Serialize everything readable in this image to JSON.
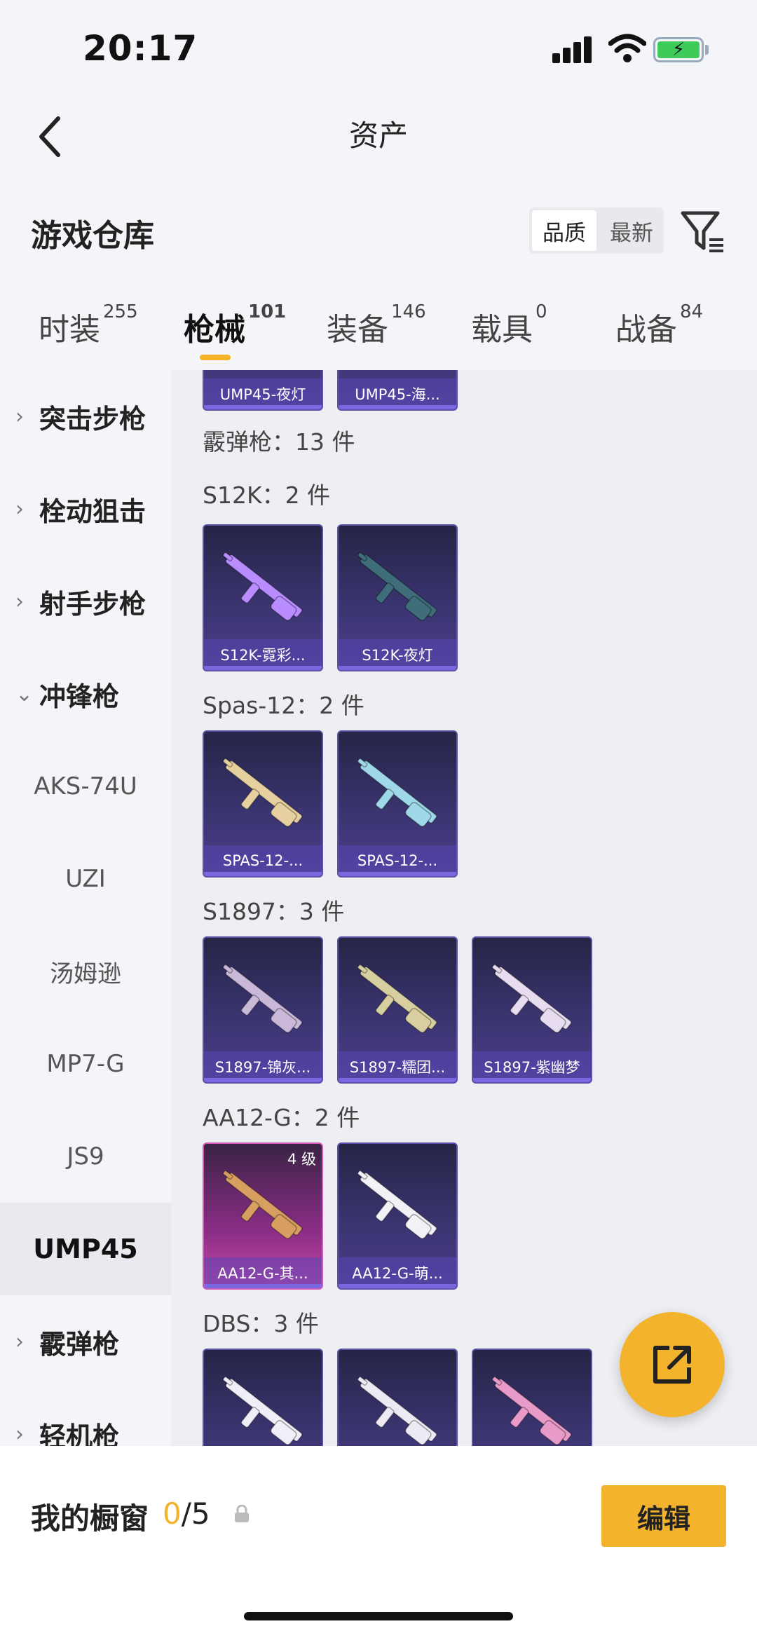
{
  "status": {
    "time": "20:17"
  },
  "nav": {
    "title": "资产"
  },
  "header": {
    "title": "游戏仓库",
    "sort_quality": "品质",
    "sort_latest": "最新"
  },
  "tabs": [
    {
      "label": "时装",
      "count": "255"
    },
    {
      "label": "枪械",
      "count": "101"
    },
    {
      "label": "装备",
      "count": "146"
    },
    {
      "label": "载具",
      "count": "0"
    },
    {
      "label": "战备",
      "count": "84"
    }
  ],
  "sidebar": {
    "items": [
      {
        "label": "突击步枪",
        "chevron": "›"
      },
      {
        "label": "栓动狙击",
        "chevron": "›"
      },
      {
        "label": "射手步枪",
        "chevron": "›"
      },
      {
        "label": "冲锋枪",
        "chevron": "⌄"
      },
      {
        "label": "AKS-74U"
      },
      {
        "label": "UZI"
      },
      {
        "label": "汤姆逊"
      },
      {
        "label": "MP7-G"
      },
      {
        "label": "JS9"
      },
      {
        "label": "UMP45"
      },
      {
        "label": "霰弹枪",
        "chevron": "›"
      },
      {
        "label": "轻机枪",
        "chevron": "›"
      }
    ]
  },
  "content": {
    "top_cards": [
      "UMP45-夜灯",
      "UMP45-海..."
    ],
    "category_title": "霰弹枪：13 件",
    "groups": [
      {
        "title": "S12K：2 件",
        "items": [
          {
            "name": "S12K-霓彩...",
            "color": "#b98cff"
          },
          {
            "name": "S12K-夜灯",
            "color": "#3f6e7a"
          }
        ]
      },
      {
        "title": "Spas-12：2 件",
        "items": [
          {
            "name": "SPAS-12-...",
            "color": "#e6d0a0"
          },
          {
            "name": "SPAS-12-...",
            "color": "#9fd8e8"
          }
        ]
      },
      {
        "title": "S1897：3 件",
        "items": [
          {
            "name": "S1897-锦灰...",
            "color": "#c9b8d8"
          },
          {
            "name": "S1897-糯团...",
            "color": "#d8cfa0"
          },
          {
            "name": "S1897-紫幽梦",
            "color": "#e8dcf0"
          }
        ]
      },
      {
        "title": "AA12-G：2 件",
        "items": [
          {
            "name": "AA12-G-其...",
            "color": "#d7a060",
            "level": "4 级"
          },
          {
            "name": "AA12-G-萌...",
            "color": "#f2f2f6"
          }
        ]
      },
      {
        "title": "DBS：3 件",
        "items": [
          {
            "name": "",
            "color": "#f0eef6"
          },
          {
            "name": "",
            "color": "#eeeaf4"
          },
          {
            "name": "",
            "color": "#e89ac8"
          }
        ]
      }
    ]
  },
  "bottom": {
    "showcase_label": "我的橱窗",
    "showcase_current": "0",
    "showcase_total": "/5",
    "edit_label": "编辑"
  },
  "colors": {
    "accent": "#f3b32c",
    "card_purple": "#3a3470",
    "card_pink": "#c94aa6"
  }
}
